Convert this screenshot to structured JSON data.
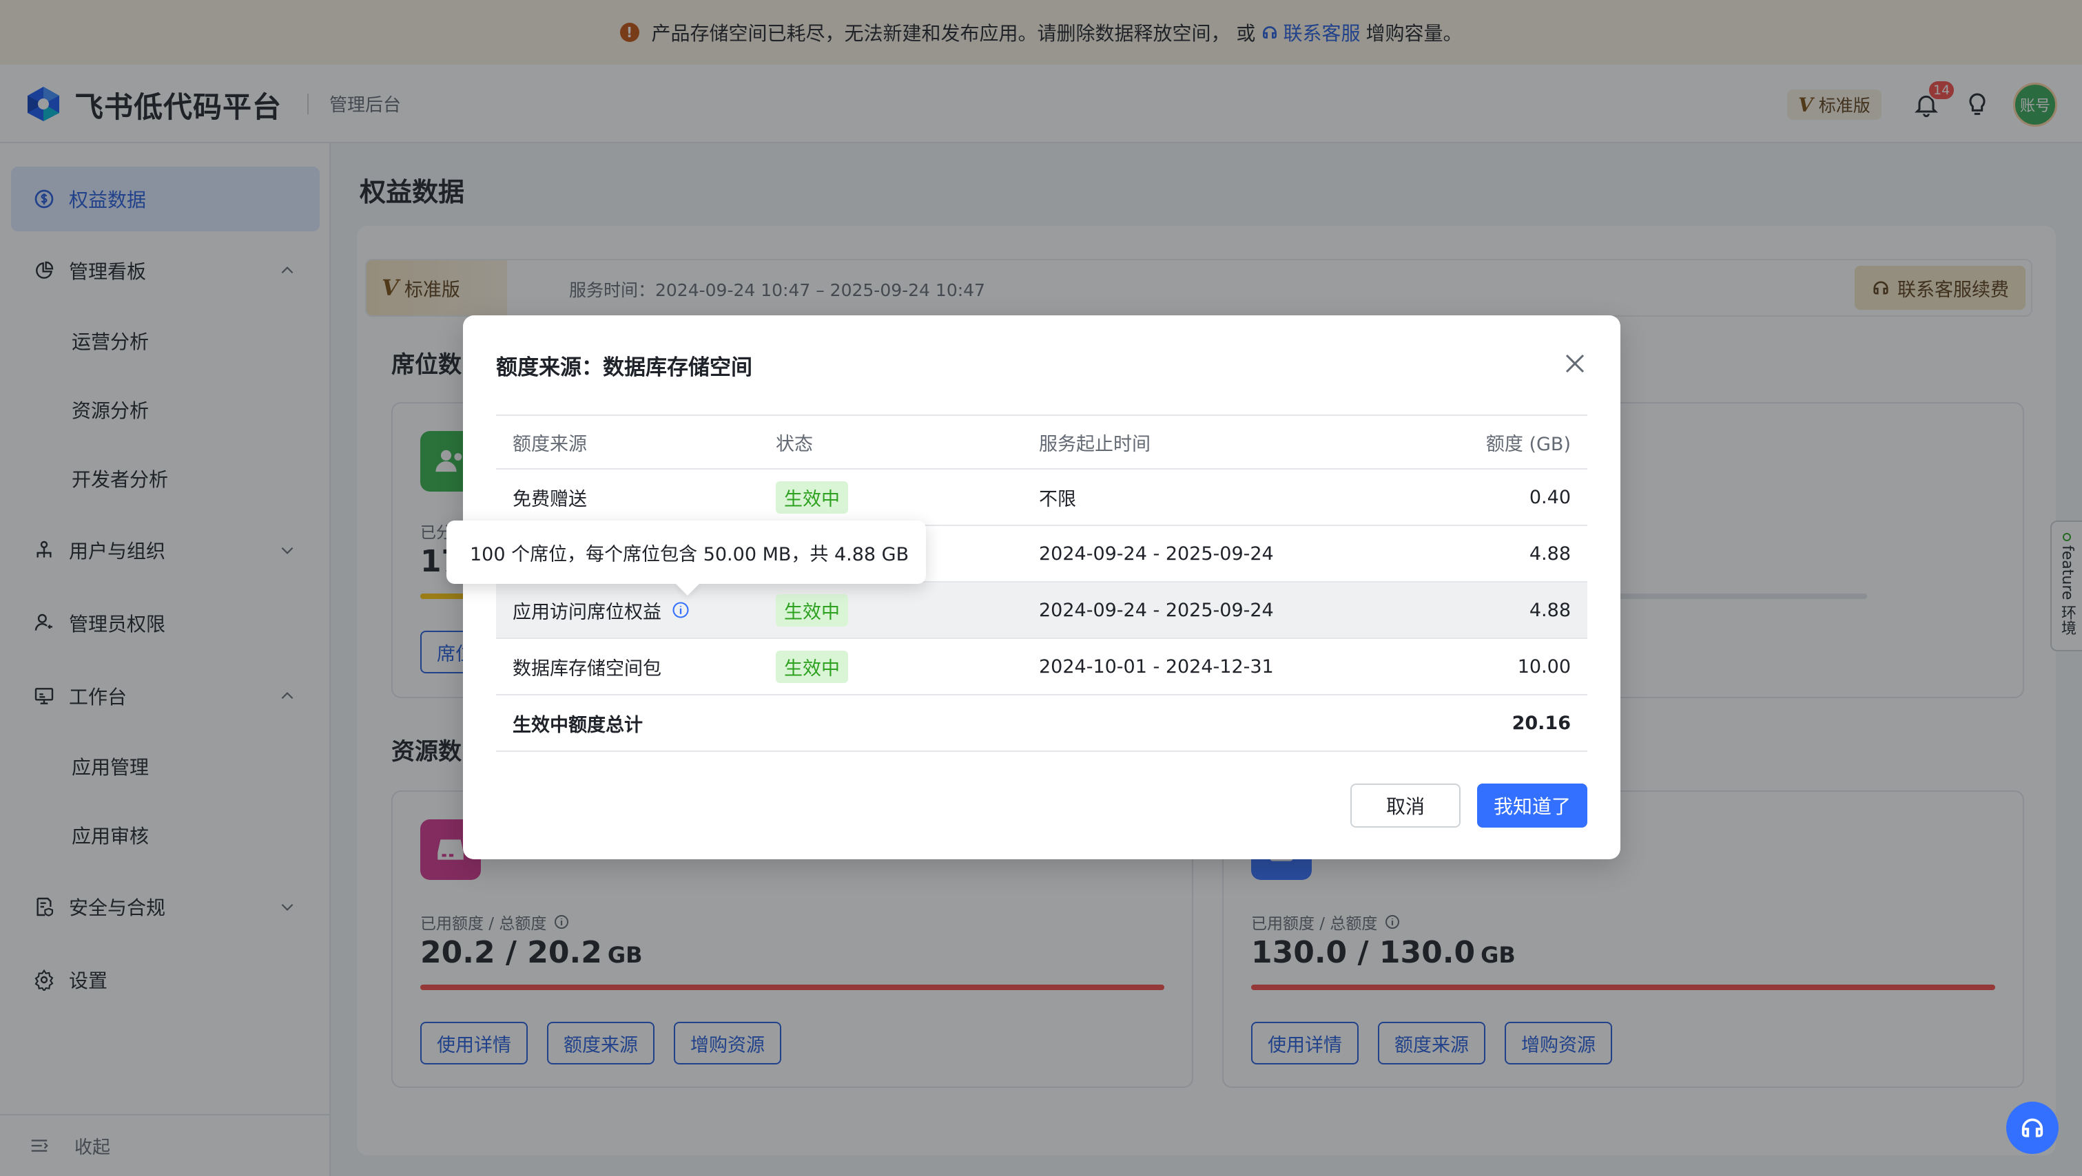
{
  "banner": {
    "text": "产品存储空间已耗尽，无法新建和发布应用。请删除数据释放空间， 或",
    "link": "联系客服",
    "suffix": "增购容量。"
  },
  "header": {
    "brand": "飞书低代码平台",
    "subtitle": "管理后台",
    "edition": "标准版",
    "edition_mark": "V",
    "notification_count": "14",
    "avatar_text": "账号"
  },
  "sidebar": {
    "items": [
      {
        "label": "权益数据"
      },
      {
        "label": "管理看板"
      },
      {
        "label": "运营分析"
      },
      {
        "label": "资源分析"
      },
      {
        "label": "开发者分析"
      },
      {
        "label": "用户与组织"
      },
      {
        "label": "管理员权限"
      },
      {
        "label": "工作台"
      },
      {
        "label": "应用管理"
      },
      {
        "label": "应用审核"
      },
      {
        "label": "安全与合规"
      },
      {
        "label": "设置"
      }
    ],
    "collapse": "收起"
  },
  "main": {
    "title": "权益数据",
    "service": {
      "edition": "标准版",
      "edition_mark": "V",
      "time": "服务时间：2024-09-24 10:47 – 2025-09-24 10:47",
      "renew": "联系客服续费"
    },
    "seat_section": "席位数",
    "seat_card": {
      "label_partial": "已分",
      "value_partial": "17",
      "button_partial": "席位"
    },
    "resource_section": "资源数",
    "storage_card": {
      "label": "已用额度 / 总额度",
      "value": "20.2 / 20.2",
      "unit": "GB",
      "used_fraction": 1.0,
      "buttons": [
        "使用详情",
        "额度来源",
        "增购资源"
      ]
    },
    "db_card": {
      "label": "已用额度 / 总额度",
      "value": "130.0 / 130.0",
      "unit": "GB",
      "used_fraction": 1.0,
      "buttons": [
        "使用详情",
        "额度来源",
        "增购资源"
      ]
    }
  },
  "modal": {
    "title": "额度来源：数据库存储空间",
    "columns": [
      "额度来源",
      "状态",
      "服务起止时间",
      "额度 (GB)"
    ],
    "rows": [
      {
        "source": "免费赠送",
        "status": "生效中",
        "period": "不限",
        "quota": "0.40"
      },
      {
        "source": "",
        "status": "",
        "period": "2024-09-24 - 2025-09-24",
        "quota": "4.88"
      },
      {
        "source": "应用访问席位权益",
        "status": "生效中",
        "period": "2024-09-24 - 2025-09-24",
        "quota": "4.88"
      },
      {
        "source": "数据库存储空间包",
        "status": "生效中",
        "period": "2024-10-01 - 2024-12-31",
        "quota": "10.00"
      }
    ],
    "total_label": "生效中额度总计",
    "total_value": "20.16",
    "cancel": "取消",
    "ok": "我知道了"
  },
  "tooltip": {
    "text": "100 个席位，每个席位包含 50.00 MB，共 4.88 GB"
  },
  "feature_tab": "feature 环境"
}
